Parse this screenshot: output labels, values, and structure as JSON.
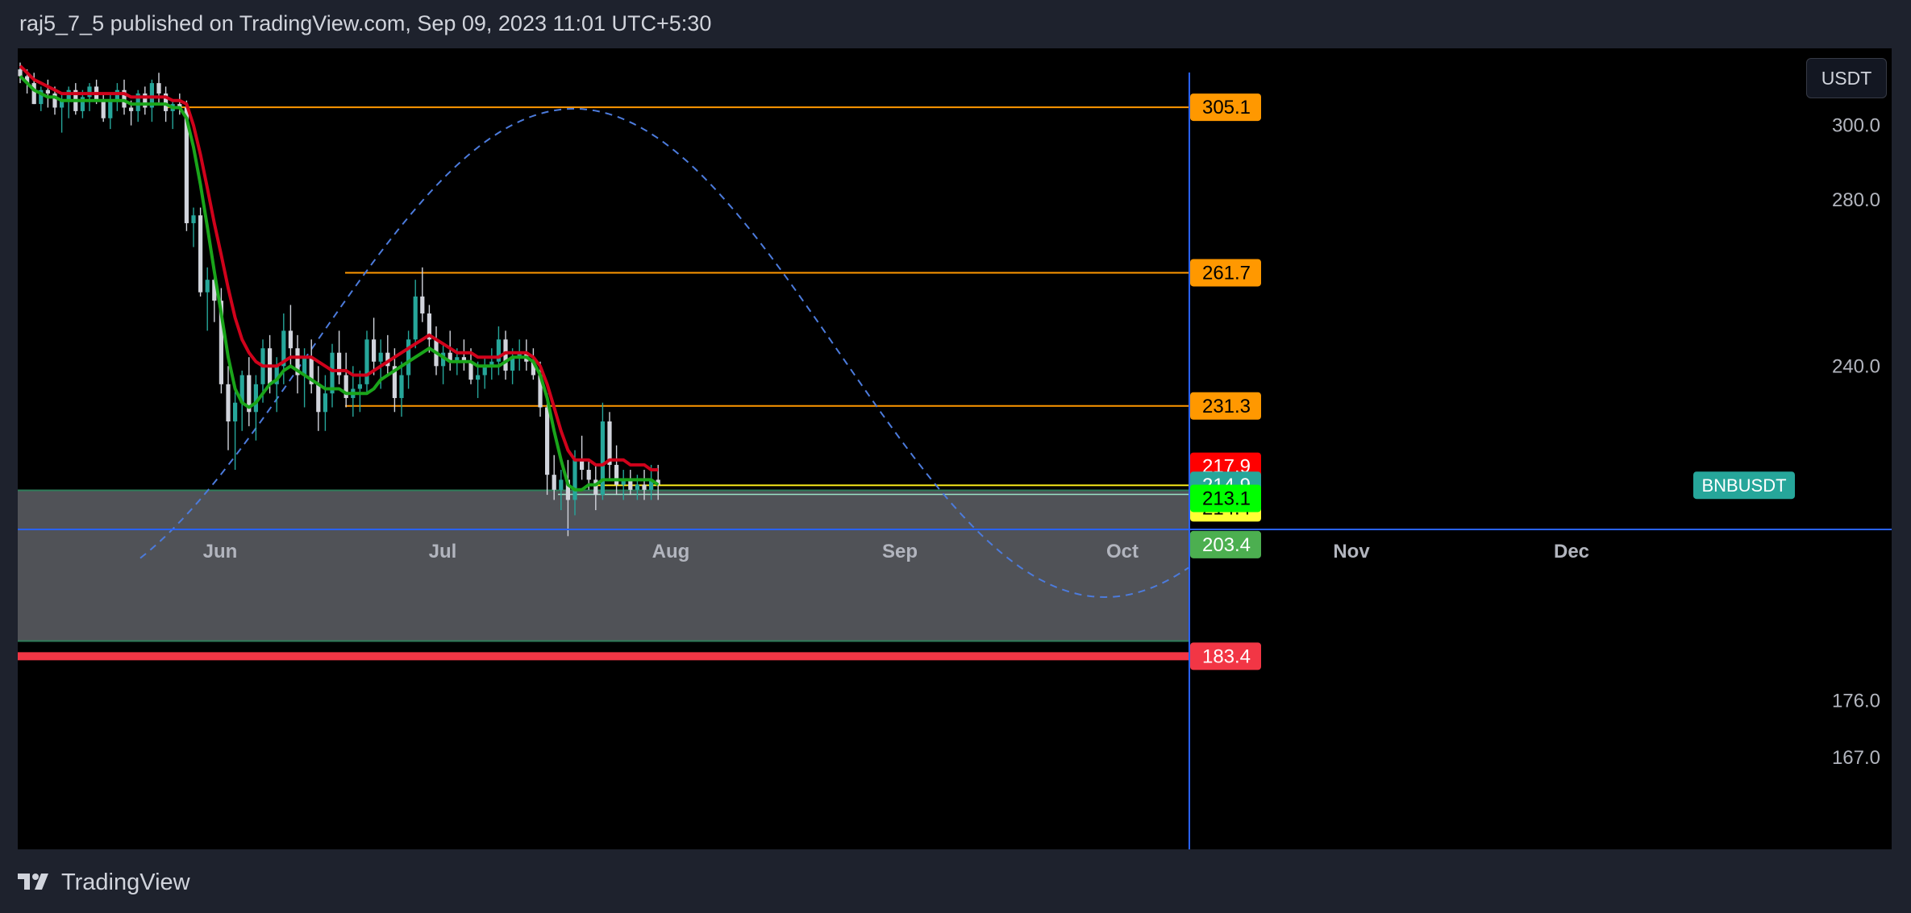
{
  "header": {
    "publish_info": "raj5_7_5 published on TradingView.com, Sep 09, 2023 11:01 UTC+5:30"
  },
  "footer": {
    "brand": "TradingView"
  },
  "currency_button": "USDT",
  "colors": {
    "background": "#000000",
    "bull_candle": "#26a69a",
    "bear_candle": "#d1d4dc",
    "ma_red": "#d0021b",
    "ma_green": "#1aa51a",
    "projection": "#4c7bdc",
    "level_line": "#ff9800",
    "price_line": "#f5e61b",
    "zone_fill": "#505257",
    "support_line": "#f23645",
    "axis_line": "#2962ff"
  },
  "chart_data": {
    "type": "candlestick",
    "symbol": "BNBUSDT",
    "x_axis": {
      "ticks": [
        "Jun",
        "Jul",
        "Aug",
        "Sep",
        "Oct",
        "Nov",
        "Dec"
      ]
    },
    "y_axis": {
      "ticks": [
        300.0,
        280.0,
        240.0,
        176.0,
        167.0
      ],
      "ylim": [
        160,
        315
      ],
      "scale": "log"
    },
    "horizontal_levels": [
      {
        "price": 305.1,
        "label": "305.1",
        "color": "#ff9800"
      },
      {
        "price": 261.7,
        "label": "261.7",
        "color": "#ff9800"
      },
      {
        "price": 231.3,
        "label": "231.3",
        "color": "#ff9800"
      },
      {
        "price": 214.9,
        "label": "214.9",
        "color": "#f5e61b"
      }
    ],
    "price_badges": [
      {
        "label": "305.1",
        "bg": "#ff9800",
        "fg": "#000000"
      },
      {
        "label": "261.7",
        "bg": "#ff9800",
        "fg": "#000000"
      },
      {
        "label": "231.3",
        "bg": "#ff9800",
        "fg": "#000000"
      },
      {
        "label": "217.9",
        "bg": "#ff0000",
        "fg": "#ffffff"
      },
      {
        "label": "214.9",
        "bg": "#26a69a",
        "fg": "#ffffff"
      },
      {
        "label": "214.4",
        "bg": "#ffff33",
        "fg": "#000000"
      },
      {
        "label": "213.1",
        "bg": "#00ff00",
        "fg": "#000000"
      },
      {
        "label": "203.4",
        "bg": "#4caf50",
        "fg": "#ffffff"
      },
      {
        "label": "183.4",
        "bg": "#f23645",
        "fg": "#ffffff"
      }
    ],
    "symbol_tag": "BNBUSDT",
    "zone": {
      "top": 213.9,
      "bottom": 186.0
    },
    "support_line": {
      "price": 183.4
    },
    "candles_ohlc": [
      [
        316,
        318,
        312,
        314
      ],
      [
        314,
        316,
        309,
        312
      ],
      [
        312,
        315,
        306,
        306
      ],
      [
        306,
        311,
        304,
        310
      ],
      [
        310,
        313,
        305,
        309
      ],
      [
        309,
        311,
        303,
        305
      ],
      [
        305,
        309,
        298,
        307
      ],
      [
        307,
        311,
        302,
        310
      ],
      [
        310,
        312,
        303,
        304
      ],
      [
        304,
        310,
        302,
        308
      ],
      [
        308,
        312,
        304,
        311
      ],
      [
        311,
        313,
        306,
        307
      ],
      [
        307,
        309,
        301,
        302
      ],
      [
        302,
        309,
        299,
        307
      ],
      [
        307,
        312,
        304,
        310
      ],
      [
        310,
        313,
        303,
        305
      ],
      [
        305,
        307,
        300,
        304
      ],
      [
        304,
        310,
        301,
        309
      ],
      [
        309,
        311,
        303,
        305
      ],
      [
        305,
        313,
        301,
        312
      ],
      [
        312,
        315,
        306,
        309
      ],
      [
        309,
        311,
        301,
        304
      ],
      [
        304,
        307,
        299,
        306
      ],
      [
        306,
        309,
        303,
        305
      ],
      [
        305,
        307,
        272,
        274
      ],
      [
        274,
        278,
        268,
        276
      ],
      [
        276,
        278,
        256,
        257
      ],
      [
        257,
        263,
        248,
        260
      ],
      [
        260,
        262,
        250,
        255
      ],
      [
        255,
        258,
        234,
        236
      ],
      [
        236,
        240,
        222,
        228
      ],
      [
        228,
        235,
        218,
        232
      ],
      [
        232,
        239,
        226,
        238
      ],
      [
        238,
        242,
        227,
        230
      ],
      [
        230,
        238,
        224,
        236
      ],
      [
        236,
        246,
        232,
        244
      ],
      [
        244,
        247,
        234,
        236
      ],
      [
        236,
        242,
        230,
        240
      ],
      [
        240,
        252,
        236,
        248
      ],
      [
        248,
        254,
        240,
        244
      ],
      [
        244,
        247,
        234,
        238
      ],
      [
        238,
        244,
        231,
        242
      ],
      [
        242,
        246,
        234,
        236
      ],
      [
        236,
        240,
        226,
        230
      ],
      [
        230,
        238,
        226,
        234
      ],
      [
        234,
        245,
        231,
        243
      ],
      [
        243,
        248,
        236,
        238
      ],
      [
        238,
        243,
        231,
        233
      ],
      [
        233,
        240,
        229,
        235
      ],
      [
        235,
        239,
        230,
        236
      ],
      [
        236,
        248,
        234,
        246
      ],
      [
        246,
        251,
        238,
        241
      ],
      [
        241,
        246,
        235,
        243
      ],
      [
        243,
        247,
        238,
        240
      ],
      [
        240,
        244,
        230,
        233
      ],
      [
        233,
        241,
        229,
        238
      ],
      [
        238,
        248,
        235,
        246
      ],
      [
        246,
        260,
        244,
        256
      ],
      [
        256,
        263,
        250,
        252
      ],
      [
        252,
        254,
        243,
        246
      ],
      [
        246,
        249,
        238,
        240
      ],
      [
        240,
        245,
        236,
        243
      ],
      [
        243,
        248,
        239,
        241
      ],
      [
        241,
        244,
        238,
        242
      ],
      [
        242,
        246,
        239,
        241
      ],
      [
        241,
        244,
        236,
        237
      ],
      [
        237,
        241,
        233,
        238
      ],
      [
        238,
        242,
        235,
        240
      ],
      [
        240,
        244,
        237,
        241
      ],
      [
        241,
        249,
        238,
        246
      ],
      [
        246,
        248,
        237,
        239
      ],
      [
        239,
        244,
        236,
        242
      ],
      [
        242,
        246,
        239,
        243
      ],
      [
        243,
        246,
        239,
        241
      ],
      [
        241,
        244,
        237,
        238
      ],
      [
        238,
        241,
        229,
        231
      ],
      [
        231,
        234,
        213,
        217
      ],
      [
        217,
        221,
        212,
        214
      ],
      [
        214,
        218,
        210,
        216
      ],
      [
        216,
        220,
        205,
        212
      ],
      [
        212,
        222,
        209,
        220
      ],
      [
        220,
        225,
        216,
        218
      ],
      [
        218,
        220,
        214,
        216
      ],
      [
        216,
        219,
        210,
        213
      ],
      [
        213,
        232,
        212,
        228
      ],
      [
        228,
        230,
        216,
        219
      ],
      [
        219,
        223,
        213,
        215
      ],
      [
        215,
        218,
        212,
        216
      ],
      [
        216,
        218,
        213,
        214
      ],
      [
        214,
        217,
        212,
        215
      ],
      [
        215,
        218,
        212,
        214
      ],
      [
        214,
        219,
        212,
        216
      ],
      [
        216,
        219,
        212,
        215
      ]
    ],
    "ma_red": [
      317,
      315,
      313,
      312,
      311,
      310,
      309,
      309,
      309,
      309,
      309,
      309,
      309,
      309,
      309,
      309,
      308,
      308,
      308,
      308,
      308,
      308,
      307,
      307,
      306,
      300,
      292,
      283,
      274,
      266,
      258,
      251,
      246,
      243,
      241,
      240,
      240,
      240,
      241,
      242,
      242,
      242,
      242,
      241,
      240,
      239,
      239,
      239,
      238,
      238,
      238,
      239,
      240,
      241,
      242,
      243,
      244,
      245,
      246,
      247,
      246,
      245,
      244,
      243,
      243,
      243,
      242,
      242,
      242,
      242,
      243,
      243,
      243,
      243,
      242,
      240,
      236,
      231,
      226,
      222,
      220,
      220,
      220,
      219,
      219,
      220,
      220,
      220,
      219,
      219,
      219,
      218,
      218
    ],
    "ma_green": [
      314,
      312,
      310,
      309,
      308,
      308,
      307,
      307,
      307,
      307,
      307,
      307,
      307,
      307,
      307,
      307,
      306,
      306,
      306,
      306,
      306,
      306,
      305,
      305,
      302,
      294,
      284,
      273,
      262,
      252,
      242,
      235,
      232,
      231,
      232,
      234,
      236,
      237,
      239,
      240,
      239,
      238,
      237,
      236,
      235,
      235,
      235,
      234,
      234,
      234,
      234,
      235,
      237,
      238,
      239,
      240,
      241,
      242,
      243,
      244,
      243,
      242,
      241,
      241,
      241,
      241,
      240,
      240,
      240,
      240,
      241,
      242,
      242,
      242,
      241,
      238,
      233,
      226,
      220,
      215,
      214,
      214,
      215,
      215,
      216,
      216,
      216,
      216,
      216,
      216,
      216,
      216,
      215
    ]
  }
}
